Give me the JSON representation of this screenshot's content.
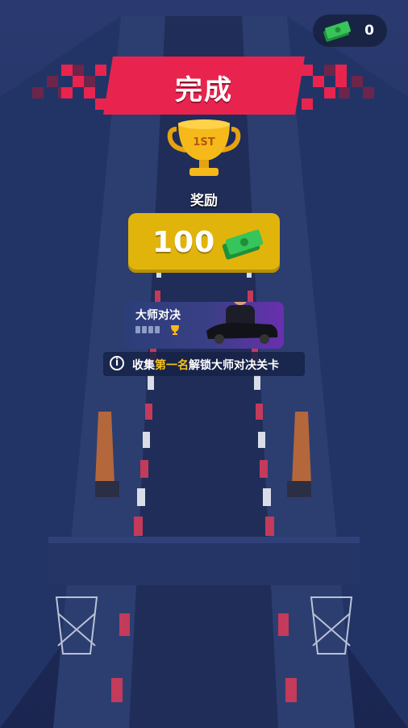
{
  "currency": {
    "icon": "cash-stack-icon",
    "value": "0"
  },
  "banner": {
    "title": "完成"
  },
  "trophy": {
    "icon": "gold-trophy-icon",
    "rank_text": "1ST"
  },
  "reward": {
    "label": "奖励",
    "amount": "100",
    "icon": "cash-stack-icon"
  },
  "master": {
    "name": "大师对决",
    "progress_collected": 0,
    "progress_total": 4,
    "icon": "trophy-icon"
  },
  "info": {
    "icon": "info-icon",
    "prefix": "收集",
    "highlight": "第一名",
    "suffix": "解锁大师对决关卡"
  },
  "colors": {
    "banner_red": "#e8244e",
    "reward_gold": "#e1b40b",
    "highlight": "#f6c21b",
    "track_blue": "#1c2a55"
  }
}
